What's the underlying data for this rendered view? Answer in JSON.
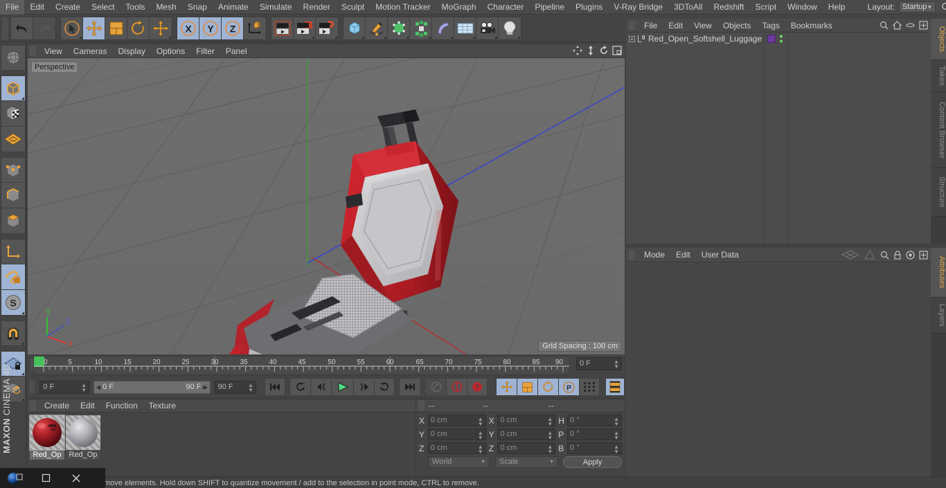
{
  "menubar": {
    "items": [
      "File",
      "Edit",
      "Create",
      "Select",
      "Tools",
      "Mesh",
      "Snap",
      "Animate",
      "Simulate",
      "Render",
      "Sculpt",
      "Motion Tracker",
      "MoGraph",
      "Character",
      "Pipeline",
      "Plugins",
      "V-Ray Bridge",
      "3DToAll",
      "Redshift",
      "Script",
      "Window",
      "Help"
    ],
    "layout_label": "Layout:",
    "layout_value": "Startup",
    "search_icon": "search-icon"
  },
  "toolbar": {
    "undo": "undo-icon",
    "redo": "redo-icon",
    "live_selection": "live-selection-icon",
    "move": "move-tool-icon",
    "scale": "scale-tool-icon",
    "rotate": "rotate-tool-icon",
    "move_alt": "move-alt-icon",
    "axis_x": "X",
    "axis_y": "Y",
    "axis_z": "Z",
    "world_axis": "world-coordinate-icon",
    "render_view": "render-view-icon",
    "render_region": "render-region-icon",
    "render_settings": "render-settings-icon",
    "primitives": "cube-primitive-icon",
    "spline": "spline-pen-icon",
    "generator": "generator-icon",
    "deformer": "deformer-icon",
    "bend": "bend-icon",
    "scene": "scene-floor-icon",
    "camera": "camera-icon",
    "light": "light-icon"
  },
  "lefttool": {
    "items": [
      {
        "name": "undo-view-icon",
        "selected": false
      },
      {
        "name": "model-mode-icon",
        "selected": true
      },
      {
        "name": "texture-mode-icon",
        "selected": false
      },
      {
        "name": "polygon-axis-icon",
        "selected": false
      },
      {
        "name": "point-mode-icon",
        "selected": false
      },
      {
        "name": "edge-mode-icon",
        "selected": false
      },
      {
        "name": "polygon-mode-icon",
        "selected": false
      },
      {
        "name": "axis-mode-icon",
        "selected": false
      },
      {
        "name": "enable-snap-icon",
        "selected": true
      },
      {
        "name": "snap-s-icon",
        "selected": true
      },
      {
        "name": "magnet-icon",
        "selected": false
      },
      {
        "name": "workplane-lock-icon",
        "selected": true
      },
      {
        "name": "workplane-rotate-icon",
        "selected": false
      }
    ],
    "brand_line1": "MAXON",
    "brand_line2": "CINEMA 4D"
  },
  "viewport": {
    "menu": [
      "View",
      "Cameras",
      "Display",
      "Options",
      "Filter",
      "Panel"
    ],
    "label": "Perspective",
    "grid_spacing": "Grid Spacing : 100 cm",
    "axis_x": "X",
    "axis_y": "Y",
    "axis_z": "Z",
    "icons": [
      "move-view-icon",
      "zoom-view-icon",
      "rotate-view-icon",
      "maximize-view-icon"
    ]
  },
  "timeline": {
    "ticks": [
      "0",
      "5",
      "10",
      "15",
      "20",
      "25",
      "30",
      "35",
      "40",
      "45",
      "50",
      "55",
      "60",
      "65",
      "70",
      "75",
      "80",
      "85",
      "90"
    ],
    "current_frame": "0 F",
    "start_frame": "0 F",
    "range_start": "0 F",
    "range_end": "90 F",
    "end_frame": "90 F",
    "buttons": [
      {
        "name": "go-to-start-button",
        "sel": false
      },
      {
        "name": "previous-key-button",
        "sel": false
      },
      {
        "name": "step-back-button",
        "sel": false
      },
      {
        "name": "play-button",
        "sel": false
      },
      {
        "name": "step-forward-button",
        "sel": false
      },
      {
        "name": "next-key-button",
        "sel": false
      },
      {
        "name": "go-to-end-button",
        "sel": false
      },
      {
        "name": "record-active-objects-button",
        "sel": false
      },
      {
        "name": "autokeying-button",
        "sel": false
      },
      {
        "name": "keyframe-selection-button",
        "sel": false
      },
      {
        "name": "position-key-button",
        "sel": true
      },
      {
        "name": "scale-key-button",
        "sel": true
      },
      {
        "name": "rotation-key-button",
        "sel": true
      },
      {
        "name": "parameter-key-button",
        "sel": true
      },
      {
        "name": "point-level-animation-button",
        "sel": false
      },
      {
        "name": "timeline-button",
        "sel": true
      }
    ]
  },
  "materials": {
    "menu": [
      "Create",
      "Edit",
      "Function",
      "Texture"
    ],
    "items": [
      {
        "name": "Red_Op",
        "color": "#8e1c1c",
        "selected": true
      },
      {
        "name": "Red_Op",
        "color": "#a8a8ad",
        "selected": false
      }
    ]
  },
  "coordinates": {
    "header": [
      "--",
      "--",
      "--"
    ],
    "rows": [
      {
        "label1": "X",
        "value1": "0 cm",
        "label2": "X",
        "value2": "0 cm",
        "label3": "H",
        "value3": "0 °"
      },
      {
        "label1": "Y",
        "value1": "0 cm",
        "label2": "Y",
        "value2": "0 cm",
        "label3": "P",
        "value3": "0 °"
      },
      {
        "label1": "Z",
        "value1": "0 cm",
        "label2": "Z",
        "value2": "0 cm",
        "label3": "B",
        "value3": "0 °"
      }
    ],
    "system": "World",
    "mode": "Scale",
    "apply": "Apply"
  },
  "objects": {
    "menu": [
      "File",
      "Edit",
      "View",
      "Objects",
      "Tags",
      "Bookmarks"
    ],
    "icons": [
      "search-icon",
      "home-icon",
      "ellipse-icon",
      "fullscreen-icon"
    ],
    "rows": [
      {
        "name": "Red_Open_Softshell_Luggage",
        "layer_badge": "0",
        "tag_color": "#6b3a9e"
      }
    ]
  },
  "attributes": {
    "menu": [
      "Mode",
      "Edit",
      "User Data"
    ],
    "icons": [
      "mesh-icon",
      "cone-icon",
      "search-icon",
      "lock-icon",
      "target-icon",
      "fullscreen-icon"
    ]
  },
  "right_tabs_top": [
    {
      "label": "Objects",
      "active": true
    },
    {
      "label": "Takes",
      "active": false
    },
    {
      "label": "Content Browser",
      "active": false
    },
    {
      "label": "Structure",
      "active": false
    }
  ],
  "right_tabs_bottom": [
    {
      "label": "Attributes",
      "active": true
    },
    {
      "label": "Layers",
      "active": false
    }
  ],
  "statusbar": {
    "text": "move elements. Hold down SHIFT to quantize movement / add to the selection in point mode, CTRL to remove."
  },
  "taskbar": {
    "icons": [
      "c4d-app-icon",
      "window-restore-icon",
      "window-maximize-icon",
      "window-close-icon"
    ]
  },
  "colors": {
    "panel_bg": "#444444",
    "menu_bg": "#4a4a4a",
    "viewport_bg": "#6d6d6d",
    "selection_blue": "#9fb4d4",
    "accent_orange": "#e0a64a",
    "luggage_red": "#c0232b"
  }
}
